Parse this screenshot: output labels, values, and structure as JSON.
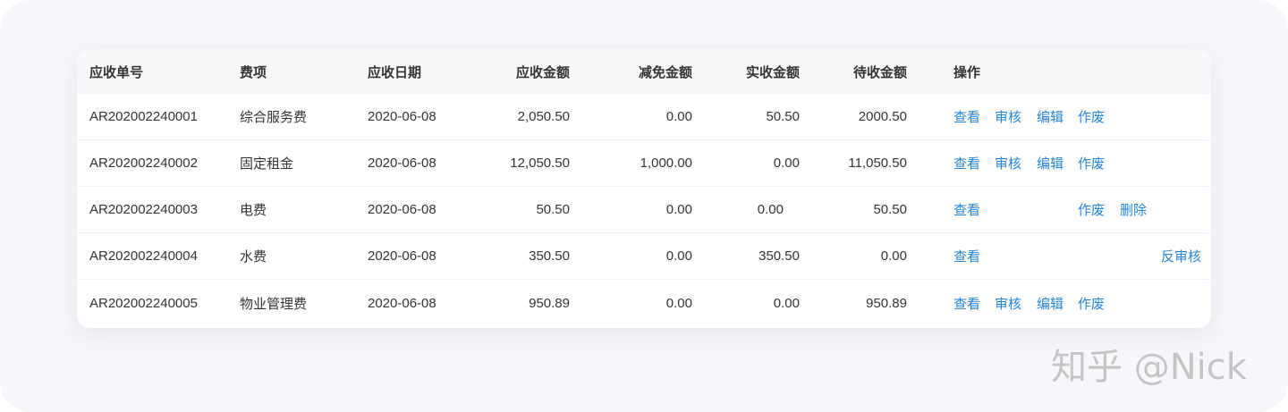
{
  "table": {
    "headers": {
      "receivable_no": "应收单号",
      "fee_item": "费项",
      "due_date": "应收日期",
      "amount_due": "应收金额",
      "amount_relief": "减免金额",
      "amount_received": "实收金额",
      "amount_pending": "待收金额",
      "operations": "操作"
    },
    "rows": [
      {
        "receivable_no": "AR202002240001",
        "fee_item": "综合服务费",
        "due_date": "2020-06-08",
        "amount_due": "2,050.50",
        "amount_relief": "0.00",
        "amount_received": "50.50",
        "amount_pending": "2000.50",
        "actions": {
          "view": "查看",
          "audit": "审核",
          "edit": "编辑",
          "void": "作废"
        }
      },
      {
        "receivable_no": "AR202002240002",
        "fee_item": "固定租金",
        "due_date": "2020-06-08",
        "amount_due": "12,050.50",
        "amount_relief": "1,000.00",
        "amount_received": "0.00",
        "amount_pending": "11,050.50",
        "actions": {
          "view": "查看",
          "audit": "审核",
          "edit": "编辑",
          "void": "作废"
        }
      },
      {
        "receivable_no": "AR202002240003",
        "fee_item": "电费",
        "due_date": "2020-06-08",
        "amount_due": "50.50",
        "amount_relief": "0.00",
        "amount_received": "0.00",
        "amount_pending": "50.50",
        "actions": {
          "view": "查看",
          "void": "作废",
          "delete": "删除"
        }
      },
      {
        "receivable_no": "AR202002240004",
        "fee_item": "水费",
        "due_date": "2020-06-08",
        "amount_due": "350.50",
        "amount_relief": "0.00",
        "amount_received": "350.50",
        "amount_pending": "0.00",
        "actions": {
          "view": "查看",
          "reaudit": "反审核"
        }
      },
      {
        "receivable_no": "AR202002240005",
        "fee_item": "物业管理费",
        "due_date": "2020-06-08",
        "amount_due": "950.89",
        "amount_relief": "0.00",
        "amount_received": "0.00",
        "amount_pending": "950.89",
        "actions": {
          "view": "查看",
          "audit": "审核",
          "edit": "编辑",
          "void": "作废"
        }
      }
    ]
  },
  "watermark": "知乎 @Nick",
  "colors": {
    "link": "#1f86e0",
    "header_bg": "#f7f8fa",
    "backdrop": "#f6f7fb",
    "text": "#333333"
  }
}
